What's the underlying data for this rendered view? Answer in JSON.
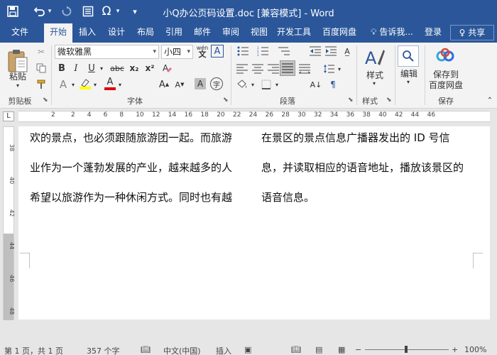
{
  "window": {
    "title": "小Q办公页码设置.doc [兼容模式] - Word"
  },
  "quick_access": {
    "save_icon": "save-icon",
    "undo_icon": "undo-icon",
    "redo_icon": "redo-icon",
    "doc_icon": "document-icon",
    "omega_label": "Ω",
    "customize_icon": "customize-icon"
  },
  "tabs": [
    {
      "label": "文件"
    },
    {
      "label": "开始"
    },
    {
      "label": "插入"
    },
    {
      "label": "设计"
    },
    {
      "label": "布局"
    },
    {
      "label": "引用"
    },
    {
      "label": "邮件"
    },
    {
      "label": "审阅"
    },
    {
      "label": "视图"
    },
    {
      "label": "开发工具"
    },
    {
      "label": "百度网盘"
    }
  ],
  "tell_me": "告诉我...",
  "login": "登录",
  "share": "共享",
  "ribbon": {
    "paste_label": "粘贴",
    "clipboard_label": "剪贴板",
    "font_name": "微软雅黑",
    "font_size": "小四",
    "wen_label": "wén",
    "font_group_label": "字体",
    "paragraph_label": "段落",
    "styles_label": "样式",
    "styles_group_label": "样式",
    "edit_label": "编辑",
    "save_to_label_1": "保存到",
    "save_to_label_2": "百度网盘",
    "save_group_label": "保存",
    "bold": "B",
    "italic": "I",
    "underline": "U",
    "strike": "abc",
    "subscript": "x₂",
    "superscript": "x²",
    "char_border": "A",
    "char_shading": "A",
    "enclose": "字"
  },
  "ruler": {
    "ticks": [
      "2",
      "2",
      "4",
      "6",
      "8",
      "10",
      "12",
      "14",
      "16",
      "18",
      "20",
      "22",
      "24",
      "26",
      "28",
      "30",
      "32",
      "34",
      "36",
      "38",
      "40",
      "42",
      "44",
      "46"
    ],
    "vticks": [
      "38",
      "40",
      "42",
      "44",
      "46",
      "48"
    ]
  },
  "document": {
    "left_column": [
      "欢的景点，也必须跟随旅游团一起。而旅游",
      "业作为一个蓬勃发展的产业，越来越多的人",
      "希望以旅游作为一种休闲方式。同时也有越"
    ],
    "right_column": [
      "在景区的景点信息广播器发出的  ID  号信",
      "息，并读取相应的语音地址，播放该景区的",
      "语音信息。"
    ]
  },
  "status": {
    "page": "第 1 页，共 1 页",
    "words": "357 个字",
    "language": "中文(中国)",
    "mode": "插入",
    "zoom": "100%"
  },
  "colors": {
    "word_blue": "#2b579a",
    "highlight": "#ffff00",
    "font_red": "#e00000"
  }
}
